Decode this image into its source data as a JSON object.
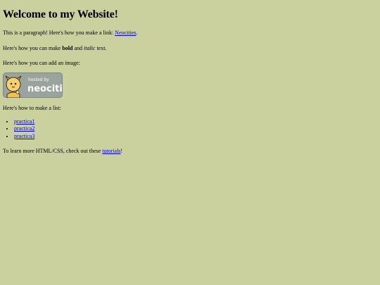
{
  "page": {
    "title": "Welcome to my Website!",
    "p1": {
      "before": "This is a paragraph! Here's how you make a link: ",
      "link": "Neocities",
      "after": "."
    },
    "p2": {
      "before": "Here's how you can make ",
      "bold": "bold",
      "middle": " and ",
      "italic": "italic",
      "after": " text."
    },
    "p3": "Here's how you can add an image:",
    "badge": {
      "text_top": "hosted by",
      "text_main": "neocities",
      "colors": {
        "bg": "#9aa39d",
        "text": "#ffffff",
        "cat": "#f2c24f"
      }
    },
    "p4": "Here's how to make a list:",
    "list": [
      {
        "label": "practica1"
      },
      {
        "label": "practica2"
      },
      {
        "label": "practica3"
      }
    ],
    "p5": {
      "before": "To learn more HTML/CSS, check out these ",
      "link": "tutorials",
      "after": "!"
    }
  },
  "colors": {
    "background": "#cbd09f",
    "link": "#0000ee"
  }
}
